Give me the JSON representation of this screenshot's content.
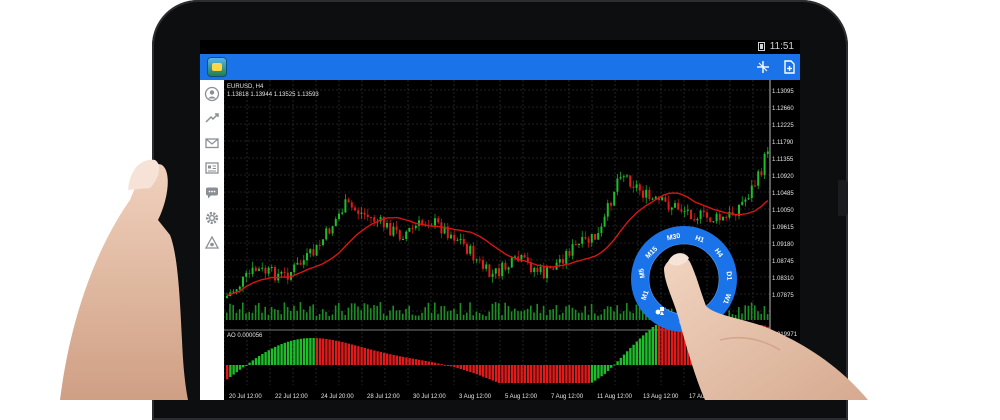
{
  "status_bar": {
    "time": "11:51"
  },
  "chart": {
    "symbol": "EURUSD, H4",
    "ohlc": "1.13818 1.13944 1.13525 1.13593",
    "price_scale": [
      "1.13095",
      "1.12660",
      "1.12225",
      "1.11790",
      "1.11355",
      "1.10920",
      "1.10485",
      "1.10050",
      "1.09615",
      "1.09180",
      "1.08745",
      "1.08310",
      "1.07875"
    ],
    "indicator": {
      "label": "AO 0.000056",
      "scale_top": "0.019971"
    },
    "date_labels": [
      "20 Jul 12:00",
      "22 Jul 12:00",
      "24 Jul 20:00",
      "28 Jul 12:00",
      "30 Jul 12:00",
      "3 Aug 12:00",
      "5 Aug 12:00",
      "7 Aug 12:00",
      "11 Aug 12:00",
      "13 Aug 12:00",
      "17 Aug 12:00"
    ]
  },
  "timeframes": [
    "M1",
    "M5",
    "M15",
    "M30",
    "H1",
    "H4",
    "D1",
    "W1"
  ],
  "colors": {
    "accent": "#1a73e8",
    "bull": "#1ebd2c",
    "bear": "#e01b1b",
    "ma": "#d81414"
  },
  "icons": {
    "appbar": [
      "app-logo-icon",
      "crosshair-icon",
      "new-order-icon"
    ],
    "sidebar": [
      "account-icon",
      "trade-icon",
      "mail-icon",
      "news-icon",
      "chat-icon",
      "settings-icon",
      "journal-icon"
    ]
  }
}
